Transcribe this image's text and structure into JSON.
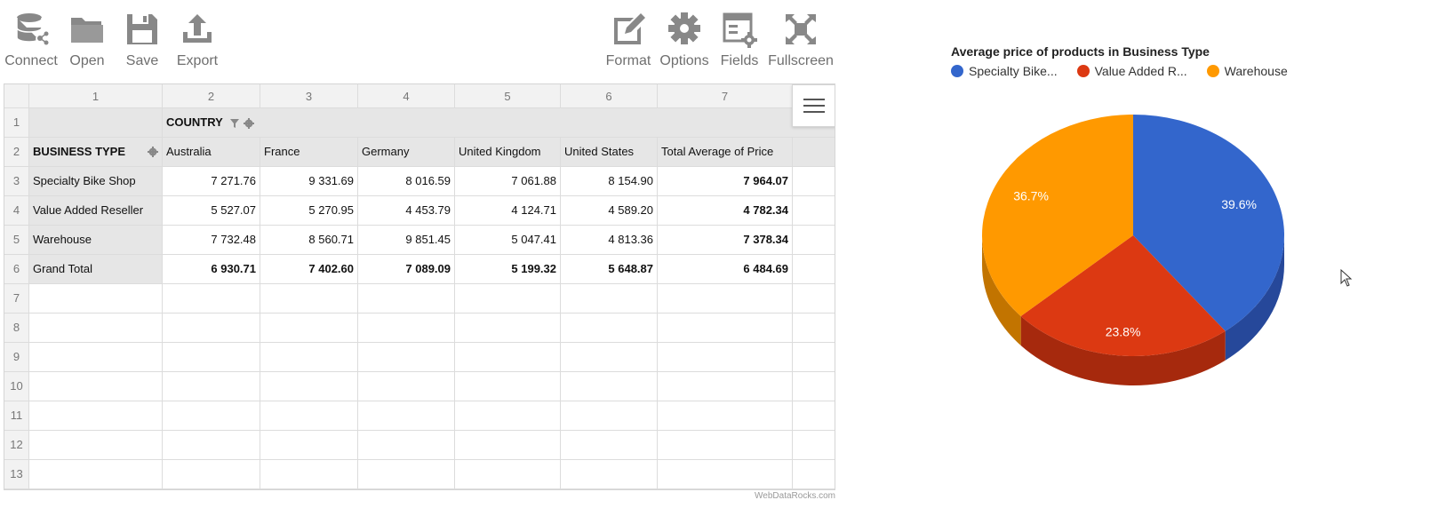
{
  "toolbar": {
    "left": [
      {
        "id": "connect",
        "label": "Connect",
        "icon": "database-icon"
      },
      {
        "id": "open",
        "label": "Open",
        "icon": "folder-icon"
      },
      {
        "id": "save",
        "label": "Save",
        "icon": "floppy-disk-icon"
      },
      {
        "id": "export",
        "label": "Export",
        "icon": "export-upload-icon"
      }
    ],
    "right": [
      {
        "id": "format",
        "label": "Format",
        "icon": "format-edit-icon"
      },
      {
        "id": "options",
        "label": "Options",
        "icon": "gear-icon"
      },
      {
        "id": "fields",
        "label": "Fields",
        "icon": "fields-icon"
      },
      {
        "id": "fullscreen",
        "label": "Fullscreen",
        "icon": "fullscreen-icon"
      }
    ]
  },
  "grid": {
    "column_numbers": [
      "1",
      "2",
      "3",
      "4",
      "5",
      "6",
      "7"
    ],
    "row_numbers": [
      "1",
      "2",
      "3",
      "4",
      "5",
      "6",
      "7",
      "8",
      "9",
      "10",
      "11",
      "12",
      "13"
    ],
    "column_field": "COUNTRY",
    "row_field": "BUSINESS TYPE",
    "columns": [
      "Australia",
      "France",
      "Germany",
      "United Kingdom",
      "United States",
      "Total Average of Price"
    ],
    "rows": [
      {
        "label": "Specialty Bike Shop",
        "values": [
          "7 271.76",
          "9 331.69",
          "8 016.59",
          "7 061.88",
          "8 154.90",
          "7 964.07"
        ]
      },
      {
        "label": "Value Added Reseller",
        "values": [
          "5 527.07",
          "5 270.95",
          "4 453.79",
          "4 124.71",
          "4 589.20",
          "4 782.34"
        ]
      },
      {
        "label": "Warehouse",
        "values": [
          "7 732.48",
          "8 560.71",
          "9 851.45",
          "5 047.41",
          "4 813.36",
          "7 378.34"
        ]
      }
    ],
    "grand_total": {
      "label": "Grand Total",
      "values": [
        "6 930.71",
        "7 402.60",
        "7 089.09",
        "5 199.32",
        "5 648.87",
        "6 484.69"
      ]
    },
    "powered_by": "WebDataRocks.com"
  },
  "chart_data": {
    "type": "pie",
    "title": "Average price of products in Business Type",
    "legend_placement": "top-left",
    "legend": [
      "Specialty Bike...",
      "Value Added R...",
      "Warehouse"
    ],
    "categories": [
      "Specialty Bike Shop",
      "Value Added Reseller",
      "Warehouse"
    ],
    "values": [
      39.6,
      23.8,
      36.7
    ],
    "labels": [
      "39.6%",
      "23.8%",
      "36.7%"
    ],
    "colors": [
      "#3366cc",
      "#dc3912",
      "#ff9900"
    ],
    "side_colors": [
      "#26489a",
      "#a6290d",
      "#c27400"
    ]
  }
}
